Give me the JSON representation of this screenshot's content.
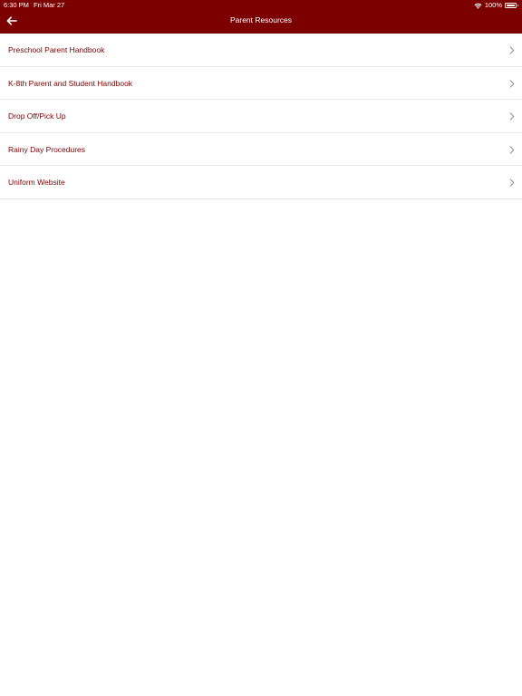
{
  "status_bar": {
    "time": "6:30 PM",
    "date": "Fri Mar 27",
    "wifi_icon": "wifi-icon",
    "battery_percent": "100%",
    "battery_icon": "battery-full-icon"
  },
  "nav": {
    "back_icon": "arrow-left-icon",
    "title": "Parent Resources"
  },
  "colors": {
    "header_bg": "#7d0000",
    "item_text": "#7d0000",
    "chevron": "#8e8e8e",
    "divider": "#e8e8e8"
  },
  "list": {
    "items": [
      {
        "label": "Preschool Parent Handbook",
        "icon": "chevron-right-icon"
      },
      {
        "label": "K-8th Parent and Student Handbook",
        "icon": "chevron-right-icon"
      },
      {
        "label": "Drop Off/Pick Up",
        "icon": "chevron-right-icon"
      },
      {
        "label": "Rainy Day Procedures",
        "icon": "chevron-right-icon"
      },
      {
        "label": "Uniform Website",
        "icon": "chevron-right-icon"
      }
    ]
  }
}
